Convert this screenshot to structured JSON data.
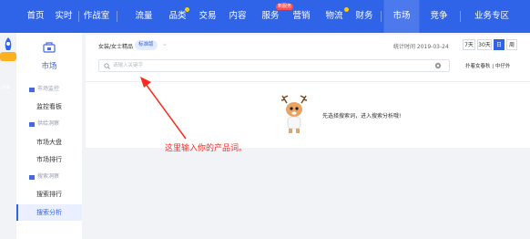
{
  "nav": {
    "items": [
      "首页",
      "实时",
      "作战室",
      "流量",
      "品类",
      "交易",
      "内容",
      "服务",
      "营销",
      "物流",
      "财务",
      "市场",
      "竞争",
      "业务专区"
    ],
    "hot_badge": "新服务",
    "active": "市场"
  },
  "vip": {
    "label": "决策"
  },
  "sidebar": {
    "title": "市场",
    "groups": [
      {
        "label": "市场监控",
        "items": [
          "监控看板"
        ]
      },
      {
        "label": "供给洞察",
        "items": [
          "市场大盘",
          "市场排行"
        ]
      },
      {
        "label": "搜索洞察",
        "items": [
          "搜索排行",
          "搜索分析"
        ]
      }
    ],
    "active_item": "搜索分析"
  },
  "header": {
    "breadcrumb": "女装/女士精品",
    "tag": "标准版",
    "stat_time": "统计时间 2019-03-24",
    "ranges": [
      "7天",
      "30天",
      "日",
      "周"
    ],
    "active_range": "日"
  },
  "search": {
    "placeholder": "请输入关键字",
    "right_text": "扑着女春秋 | 中仔外"
  },
  "empty": {
    "message": "先选择搜索词，进入搜索分析哦!"
  },
  "annotation": {
    "text": "这里输入你的产品词。",
    "color": "#ff2a1f"
  },
  "colors": {
    "brand": "#2f63e8",
    "annotation": "#ff2a1f"
  }
}
